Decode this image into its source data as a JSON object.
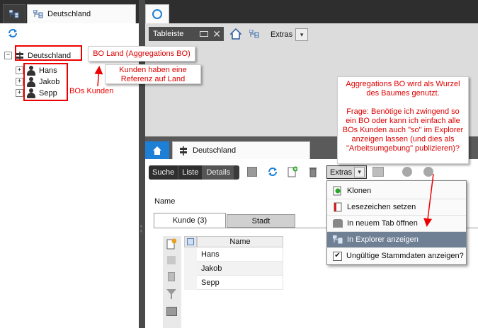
{
  "left_panel": {
    "tab_label": "Deutschland",
    "tree": {
      "root": "Deutschland",
      "children": [
        "Hans",
        "Jakob",
        "Sepp"
      ]
    }
  },
  "top_right": {
    "toolbar_label": "Tableiste",
    "extras_label": "Extras"
  },
  "detail": {
    "tab_label": "Deutschland",
    "nav": {
      "search": "Suche",
      "list": "Liste",
      "details": "Details"
    },
    "extras_label": "Extras",
    "name_label": "Name",
    "subtabs": [
      "Kunde (3)",
      "Stadt"
    ],
    "grid": {
      "column": "Name",
      "rows": [
        "Hans",
        "Jakob",
        "Sepp"
      ]
    }
  },
  "extras_menu": {
    "items": [
      "Klonen",
      "Lesezeichen setzen",
      "In neuem Tab öffnen",
      "In Explorer anzeigen",
      "Ungültige Stammdaten anzeigen?"
    ],
    "selected_index": 3,
    "checkbox_checked": true
  },
  "annotations": {
    "bo_land": "BO Land (Aggregations BO)",
    "kunden_ref": "Kunden haben eine Referenz auf Land",
    "bos_kunden": "BOs Kunden",
    "question": "Aggregations BO wird als Wurzel des Baumes genutzt.\n\nFrage: Benötige ich zwingend so ein BO oder kann ich einfach alle BOs Kunden auch \"so\" im Explorer anzeigen lassen (und dies als \"Arbeitsumgebung\" publizieren)?"
  },
  "colors": {
    "accent_blue": "#1e7fd6",
    "annotation_red": "#e00000",
    "menu_selected": "#6f7f94"
  }
}
